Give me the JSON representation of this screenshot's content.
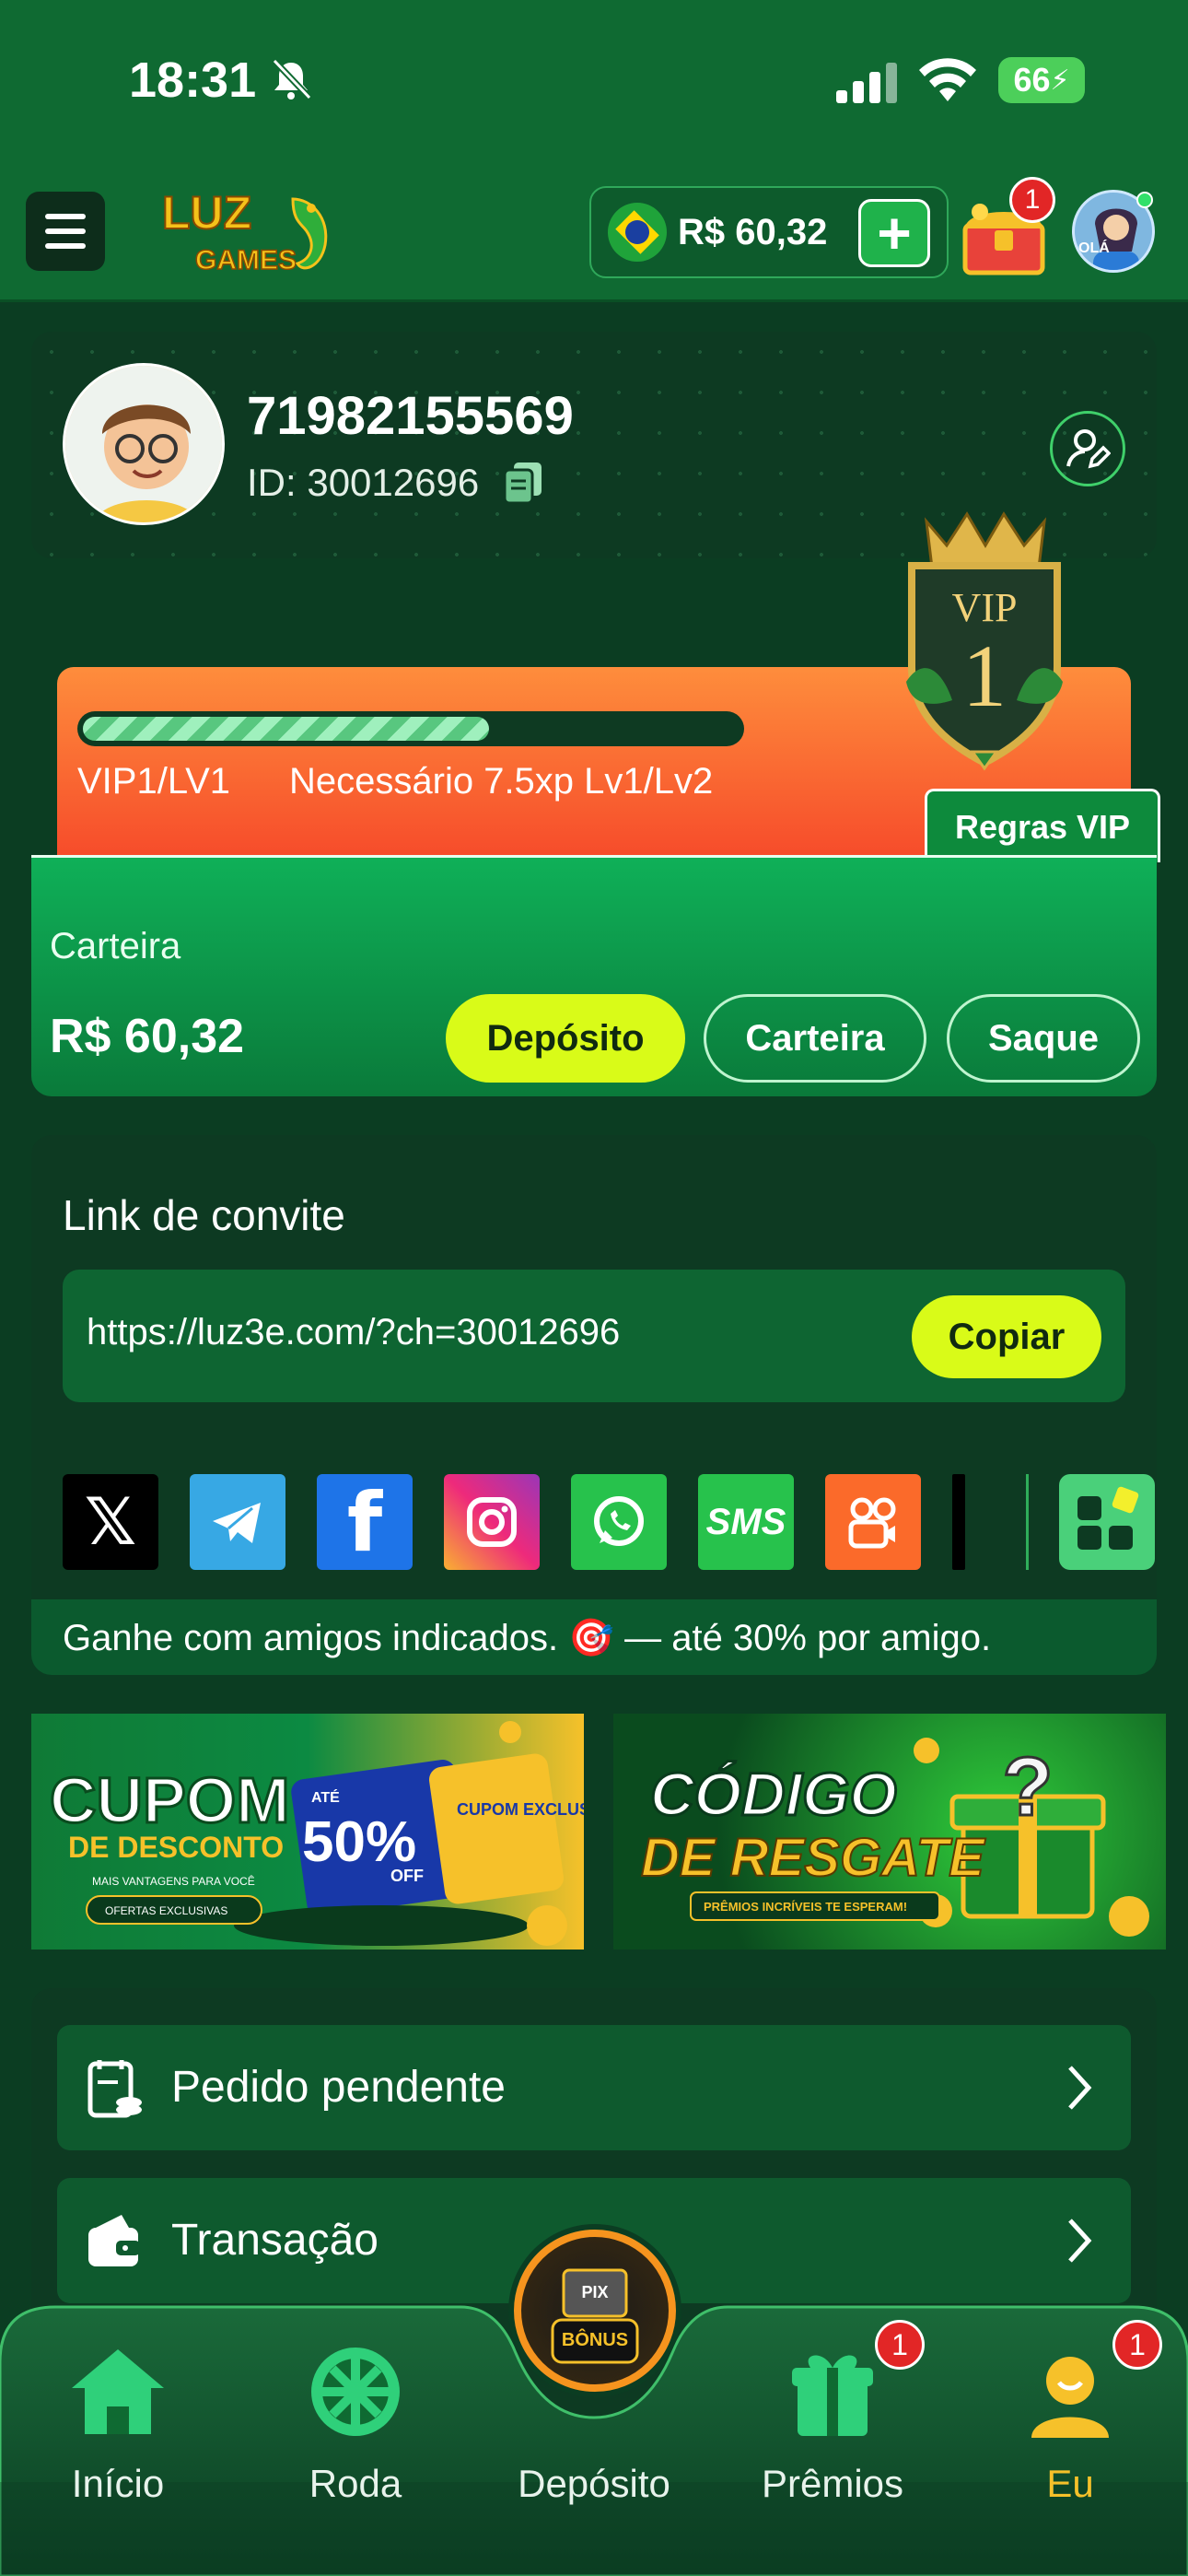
{
  "status_bar": {
    "time": "18:31",
    "battery": "66"
  },
  "header": {
    "balance": "R$ 60,32",
    "logo_text": "LUZ GAMES",
    "chest_badge": "1",
    "avatar_text": "OLÁ"
  },
  "profile": {
    "username": "71982155569",
    "user_id": "ID: 30012696"
  },
  "vip": {
    "level": "VIP1/LV1",
    "requirement": "Necessário 7.5xp Lv1/Lv2",
    "rules_button": "Regras VIP",
    "badge_title": "VIP",
    "badge_number": "1",
    "progress": 0.62
  },
  "wallet": {
    "label": "Carteira",
    "amount": "R$ 60,32",
    "deposit_button": "Depósito",
    "wallet_button": "Carteira",
    "withdraw_button": "Saque"
  },
  "invite": {
    "title": "Link de convite",
    "url": "https://luz3e.com/?ch=30012696",
    "copy_button": "Copiar",
    "share_options": [
      "X",
      "Telegram",
      "Facebook",
      "Instagram",
      "WhatsApp",
      "SMS",
      "Kwai",
      "TikTok",
      "Mais"
    ],
    "note": "Ganhe com amigos indicados. 🎯 — até 30% por amigo."
  },
  "banners": {
    "coupon": {
      "title": "CUPOM",
      "subtitle": "DE DESCONTO",
      "tagline": "MAIS VANTAGENS PARA VOCÊ",
      "cta": "OFERTAS EXCLUSIVAS",
      "upto": "ATÉ",
      "discount": "50%",
      "off": "OFF",
      "ticket": "CUPOM EXCLUSIVO"
    },
    "redeem": {
      "title": "CÓDIGO",
      "subtitle": "DE RESGATE",
      "tagline": "PRÊMIOS INCRÍVEIS TE ESPERAM!"
    }
  },
  "menu": {
    "items": [
      {
        "label": "Pedido pendente",
        "icon": "document-coins-icon"
      },
      {
        "label": "Transação",
        "icon": "wallet-icon"
      }
    ]
  },
  "bottom_nav": {
    "items": [
      {
        "label": "Início",
        "icon": "home-icon"
      },
      {
        "label": "Roda",
        "icon": "wheel-icon"
      },
      {
        "label": "Depósito",
        "icon": "pix-bonus-icon",
        "center_text_1": "PIX",
        "center_text_2": "BÔNUS"
      },
      {
        "label": "Prêmios",
        "icon": "gift-icon",
        "badge": "1"
      },
      {
        "label": "Eu",
        "icon": "user-icon",
        "badge": "1"
      }
    ]
  },
  "colors": {
    "accent": "#d9fb18",
    "primary_green": "#0f6a32",
    "active_nav": "#f6c12a",
    "badge_red": "#e22626"
  }
}
